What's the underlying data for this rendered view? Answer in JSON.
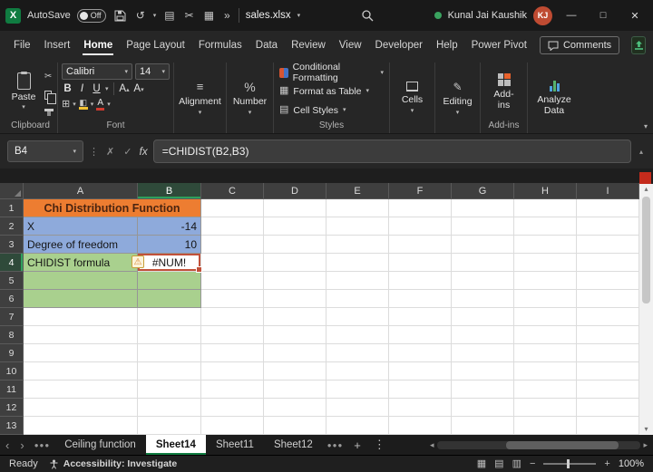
{
  "titlebar": {
    "autosave_label": "AutoSave",
    "autosave_state": "Off",
    "filename": "sales.xlsx",
    "user_name": "Kunal Jai Kaushik",
    "user_initials": "KJ"
  },
  "menubar": {
    "items": [
      "File",
      "Insert",
      "Home",
      "Page Layout",
      "Formulas",
      "Data",
      "Review",
      "View",
      "Developer",
      "Help",
      "Power Pivot"
    ],
    "active_item": "Home",
    "comments_label": "Comments"
  },
  "ribbon": {
    "paste_label": "Paste",
    "clipboard_label": "Clipboard",
    "font_name": "Calibri",
    "font_size": "14",
    "font_label": "Font",
    "alignment_label": "Alignment",
    "number_label": "Number",
    "conditional_formatting_label": "Conditional Formatting",
    "format_as_table_label": "Format as Table",
    "cell_styles_label": "Cell Styles",
    "styles_label": "Styles",
    "cells_label": "Cells",
    "editing_label": "Editing",
    "addins_label": "Add-ins",
    "addins_group_label": "Add-ins",
    "analyze_data_label": "Analyze Data"
  },
  "formula_bar": {
    "name_box": "B4",
    "formula": "=CHIDIST(B2,B3)"
  },
  "grid": {
    "columns": [
      "A",
      "B",
      "C",
      "D",
      "E",
      "F",
      "G",
      "H",
      "I"
    ],
    "rows": [
      "1",
      "2",
      "3",
      "4",
      "5",
      "6",
      "7",
      "8",
      "9",
      "10",
      "11",
      "12",
      "13"
    ],
    "selected_cell": "B4",
    "cells": [
      {
        "ref": "A1",
        "text": "Chi Distribution Function",
        "fill": "orange",
        "colspan": 2,
        "align": "center",
        "bold": true
      },
      {
        "ref": "A2",
        "text": "X",
        "fill": "blue"
      },
      {
        "ref": "B2",
        "text": "-14",
        "fill": "blue",
        "align": "right"
      },
      {
        "ref": "A3",
        "text": "Degree of freedom",
        "fill": "blue"
      },
      {
        "ref": "B3",
        "text": "10",
        "fill": "blue",
        "align": "right"
      },
      {
        "ref": "A4",
        "text": "CHIDIST formula",
        "fill": "green",
        "warning": true
      },
      {
        "ref": "B4",
        "text": "#NUM!",
        "align": "center",
        "selected": true
      },
      {
        "ref": "A5",
        "fill": "green"
      },
      {
        "ref": "B5",
        "fill": "green"
      },
      {
        "ref": "A6",
        "fill": "green"
      },
      {
        "ref": "B6",
        "fill": "green"
      }
    ]
  },
  "sheet_tabs": {
    "tabs": [
      "Ceiling function",
      "Sheet14",
      "Sheet11",
      "Sheet12"
    ],
    "active": "Sheet14"
  },
  "status_bar": {
    "ready_label": "Ready",
    "accessibility_label": "Accessibility: Investigate",
    "zoom_level": "100%"
  },
  "colors": {
    "excel_green": "#107C41",
    "title_fill_orange": "#ED7D31",
    "input_fill_blue": "#8EAADB",
    "result_fill_green": "#A9D08E",
    "selection_border": "#C1513A",
    "avatar_red": "#BF4B32",
    "scroll_marker_red": "#C42B1C"
  }
}
